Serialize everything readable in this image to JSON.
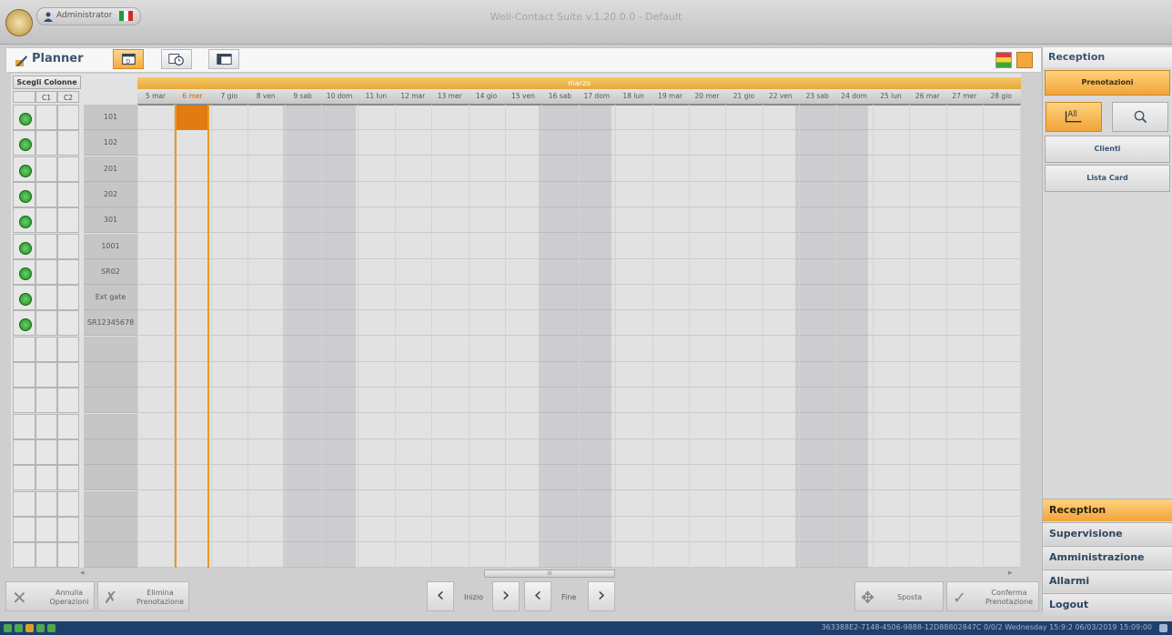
{
  "window": {
    "title": "Well-Contact Suite v.1.20.0.0 - Default",
    "user": "Administrator",
    "flag_colors": [
      "#1e9b3b",
      "#ffffff",
      "#d6262b"
    ]
  },
  "planner": {
    "title": "Planner",
    "view_buttons": [
      {
        "icon": "calendar-day-icon",
        "active": true
      },
      {
        "icon": "calendar-clock-icon",
        "active": false
      },
      {
        "icon": "calendar-layout-icon",
        "active": false
      }
    ],
    "color_buttons": [
      {
        "icon": "color-legend-icon",
        "active": false
      },
      {
        "icon": "plain-mode-icon",
        "active": true
      }
    ]
  },
  "grid": {
    "choose_columns": "Scegli Colonne",
    "columns": [
      "C1",
      "C2"
    ],
    "month": "marzo",
    "days": [
      "5 mar",
      "6 mer",
      "7 gio",
      "8 ven",
      "9 sab",
      "10 dom",
      "11 lun",
      "12 mar",
      "13 mer",
      "14 gio",
      "15 ven",
      "16 sab",
      "17 dom",
      "18 lun",
      "19 mar",
      "20 mer",
      "21 gio",
      "22 ven",
      "23 sab",
      "24 dom",
      "25 lun",
      "26 mar",
      "27 mer",
      "28 gio"
    ],
    "selected_day": "6 mer",
    "rooms": [
      "101",
      "102",
      "201",
      "202",
      "301",
      "1001",
      "SR02",
      "Ext gate",
      "SR12345678"
    ],
    "empty_rows": 9,
    "status_color": "#2c9e2c",
    "accent": "#e8921f"
  },
  "bottom": {
    "annulla": "Annulla\nOperazioni",
    "elimina": "Elimina\nPrenotazione",
    "inizio": "Inizio",
    "fine": "Fine",
    "sposta": "Sposta",
    "conferma": "Conferma\nPrenotazione"
  },
  "right_panel": {
    "header": "Reception",
    "prenotazioni": "Prenotazioni",
    "clienti": "Clienti",
    "lista_card": "Lista Card",
    "nav": [
      "Reception",
      "Supervisione",
      "Amministrazione",
      "Allarmi",
      "Logout"
    ]
  },
  "status": {
    "text": "363388E2-7148-4506-9888-12D88802847C 0/0/2 Wednesday 15:9:2 06/03/2019 15:09:00"
  }
}
